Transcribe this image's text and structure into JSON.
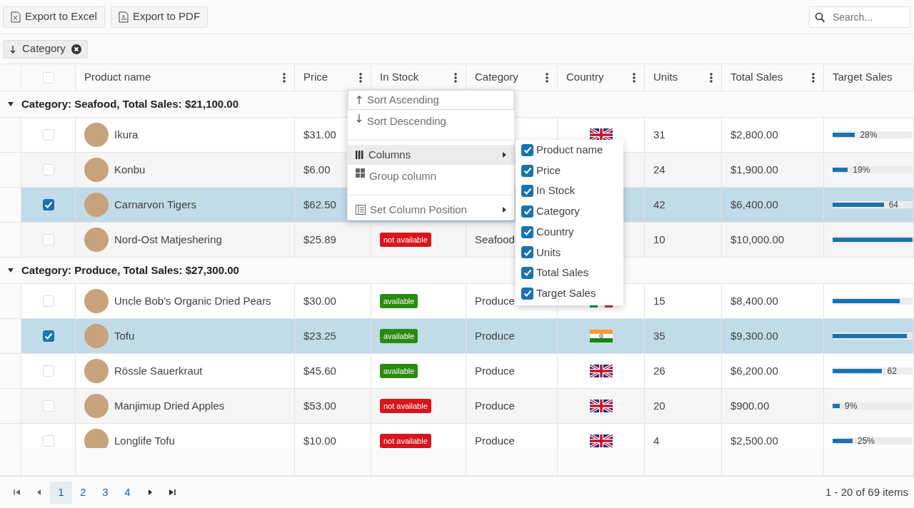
{
  "toolbar": {
    "buttons": [
      {
        "label": "Export to Excel",
        "kind": "excel"
      },
      {
        "label": "Export to PDF",
        "kind": "pdf"
      }
    ],
    "search": {
      "placeholder": "Search..."
    }
  },
  "group_panel": {
    "chips": [
      {
        "label": "Category",
        "sort_descending": true
      }
    ]
  },
  "grid": {
    "header_checkbox": {
      "checked": false
    },
    "columns": [
      {
        "label": "Product name",
        "menu": true
      },
      {
        "label": "Price",
        "menu": true
      },
      {
        "label": "In Stock",
        "menu": true
      },
      {
        "label": "Category",
        "menu": true
      },
      {
        "label": "Country",
        "menu": true
      },
      {
        "label": "Units",
        "menu": true
      },
      {
        "label": "Total Sales",
        "menu": true
      },
      {
        "label": "Target Sales",
        "menu": false
      }
    ],
    "groups": [
      {
        "title": "Category: Seafood, Total Sales: $21,100.00",
        "expanded": true,
        "rows": [
          {
            "selected": false,
            "product": "Ikura",
            "price": "$31.00",
            "flag": {
              "kind": "uk"
            },
            "units": "31",
            "total": "$2,800.00",
            "target": {
              "level": 0.28,
              "label": "28%"
            }
          },
          {
            "selected": false,
            "product": "Konbu",
            "price": "$6.00",
            "units": "24",
            "total": "$1,900.00",
            "target": {
              "level": 0.19,
              "label": "19%"
            }
          },
          {
            "selected": true,
            "product": "Carnarvon Tigers",
            "price": "$62.50",
            "units": "42",
            "total": "$6,400.00",
            "target": {
              "level": 0.64,
              "label": "64"
            }
          },
          {
            "selected": false,
            "product": "Nord-Ost Matjeshering",
            "price": "$25.89",
            "stock": {
              "available": false,
              "label": "not available"
            },
            "category": "Seafood",
            "units": "10",
            "total": "$10,000.00",
            "target": {
              "level": 1.0
            }
          }
        ]
      },
      {
        "title": "Category: Produce, Total Sales: $27,300.00",
        "expanded": true,
        "rows": [
          {
            "selected": false,
            "product": "Uncle Bob's Organic Dried Pears",
            "price": "$30.00",
            "stock": {
              "available": true,
              "label": "available"
            },
            "category": "Produce",
            "flag": {
              "kind": "it"
            },
            "units": "15",
            "total": "$8,400.00",
            "target": {
              "level": 0.84
            }
          },
          {
            "selected": true,
            "product": "Tofu",
            "price": "$23.25",
            "stock": {
              "available": true,
              "label": "available"
            },
            "category": "Produce",
            "flag": {
              "kind": "in"
            },
            "units": "35",
            "total": "$9,300.00",
            "target": {
              "level": 0.93
            }
          },
          {
            "selected": false,
            "product": "Rössle Sauerkraut",
            "price": "$45.60",
            "stock": {
              "available": true,
              "label": "available"
            },
            "category": "Produce",
            "flag": {
              "kind": "uk"
            },
            "units": "26",
            "total": "$6,200.00",
            "target": {
              "level": 0.62,
              "label": "62"
            }
          },
          {
            "selected": false,
            "product": "Manjimup Dried Apples",
            "price": "$53.00",
            "stock": {
              "available": false,
              "label": "not available"
            },
            "category": "Produce",
            "flag": {
              "kind": "uk"
            },
            "units": "20",
            "total": "$900.00",
            "target": {
              "level": 0.09,
              "label": "9%"
            }
          },
          {
            "selected": false,
            "product": "Longlife Tofu",
            "price": "$10.00",
            "stock": {
              "available": false,
              "label": "not available"
            },
            "category": "Produce",
            "flag": {
              "kind": "uk"
            },
            "units": "4",
            "total": "$2,500.00",
            "target": {
              "level": 0.25,
              "label": "25%"
            }
          }
        ]
      }
    ]
  },
  "column_menu": {
    "items": [
      {
        "kind": "sort-asc",
        "label": "Sort Ascending",
        "focused": true,
        "highlighted": false
      },
      {
        "kind": "sort-desc",
        "label": "Sort Descending",
        "focused": false,
        "highlighted": false
      },
      {
        "kind": "separator"
      },
      {
        "kind": "columns",
        "label": "Columns",
        "focused": false,
        "highlighted": true,
        "submenu": true
      },
      {
        "kind": "group",
        "label": "Group column",
        "focused": false,
        "highlighted": false
      },
      {
        "kind": "separator"
      },
      {
        "kind": "position",
        "label": "Set Column Position",
        "focused": false,
        "highlighted": false,
        "submenu": true
      }
    ]
  },
  "column_chooser": [
    {
      "label": "Product name",
      "checked": true
    },
    {
      "label": "Price",
      "checked": true
    },
    {
      "label": "In Stock",
      "checked": true
    },
    {
      "label": "Category",
      "checked": true
    },
    {
      "label": "Country",
      "checked": true
    },
    {
      "label": "Units",
      "checked": true
    },
    {
      "label": "Total Sales",
      "checked": true
    },
    {
      "label": "Target Sales",
      "checked": true
    }
  ],
  "pager": {
    "pages": [
      {
        "label": "1",
        "selected": true
      },
      {
        "label": "2",
        "selected": false
      },
      {
        "label": "3",
        "selected": false
      },
      {
        "label": "4",
        "selected": false
      }
    ],
    "info": "1 - 20 of 69 items"
  }
}
